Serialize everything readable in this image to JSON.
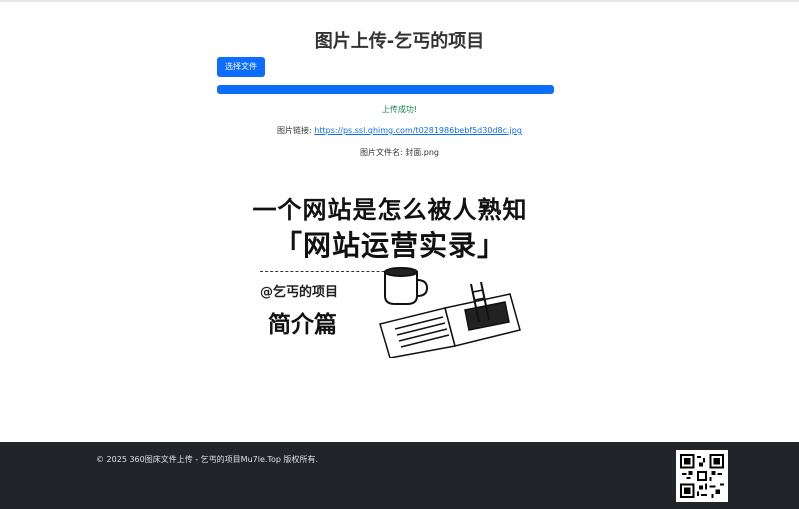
{
  "page": {
    "title": "图片上传-乞丐的项目"
  },
  "upload": {
    "choose_button": "选择文件",
    "progress_value": 1.0,
    "progress_color": "#0d6efd",
    "success_message": "上传成功!",
    "link_label": "图片链接: ",
    "link_url": "https://ps.ssl.qhimg.com/t0281986bebf5d30d8c.jpg",
    "filename_label": "图片文件名: ",
    "filename": "封面.png"
  },
  "preview_image": {
    "line1": "一个网站是怎么被人熟知",
    "line2": "「网站运营实录」",
    "tag": "@乞丐的项目",
    "line3": "简介篇"
  },
  "footer": {
    "copyright": "© 2025 360图床文件上传 - 乞丐的项目Mu7le.Top 版权所有.",
    "qr_icon": "qr-code-icon"
  },
  "colors": {
    "primary": "#0d6efd",
    "success": "#198754",
    "footer_bg": "#212529"
  }
}
